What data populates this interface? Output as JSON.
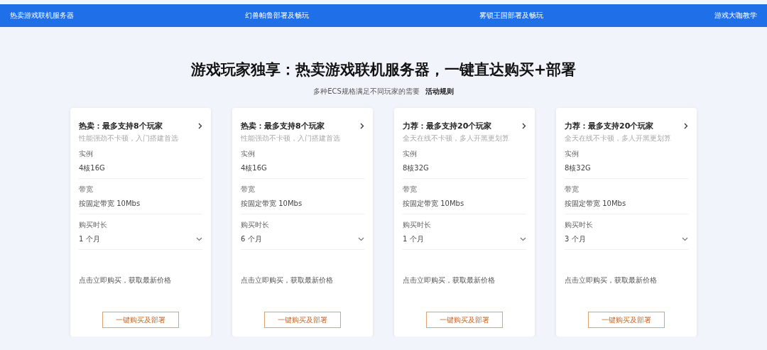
{
  "nav": {
    "items": [
      "热卖游戏联机服务器",
      "幻兽帕鲁部署及畅玩",
      "雾锁王国部署及畅玩",
      "游戏大咖教学"
    ]
  },
  "hero": {
    "title": "游戏玩家独享：热卖游戏联机服务器，一键直达购买+部署",
    "subtitle": "多种ECS规格满足不同玩家的需要",
    "rules_link": "活动规则"
  },
  "cards": [
    {
      "title": "热卖：最多支持8个玩家",
      "subtitle": "性能强劲不卡顿，入门搭建首选",
      "fields": [
        {
          "label": "实例",
          "value": "4核16G",
          "kind": "text"
        },
        {
          "label": "带宽",
          "value": "按固定带宽 10Mbs",
          "kind": "text"
        },
        {
          "label": "购买时长",
          "value": "1 个月",
          "kind": "select"
        }
      ],
      "note": "点击立即购买，获取最新价格",
      "button": "一键购买及部署"
    },
    {
      "title": "热卖：最多支持8个玩家",
      "subtitle": "性能强劲不卡顿，入门搭建首选",
      "fields": [
        {
          "label": "实例",
          "value": "4核16G",
          "kind": "text"
        },
        {
          "label": "带宽",
          "value": "按固定带宽 10Mbs",
          "kind": "text"
        },
        {
          "label": "购买时长",
          "value": "6 个月",
          "kind": "select"
        }
      ],
      "note": "点击立即购买，获取最新价格",
      "button": "一键购买及部署"
    },
    {
      "title": "力荐：最多支持20个玩家",
      "subtitle": "全天在线不卡顿，多人开黑更划算",
      "fields": [
        {
          "label": "实例",
          "value": "8核32G",
          "kind": "text"
        },
        {
          "label": "带宽",
          "value": "按固定带宽 10Mbs",
          "kind": "text"
        },
        {
          "label": "购买时长",
          "value": "1 个月",
          "kind": "select"
        }
      ],
      "note": "点击立即购买，获取最新价格",
      "button": "一键购买及部署"
    },
    {
      "title": "力荐：最多支持20个玩家",
      "subtitle": "全天在线不卡顿，多人开黑更划算",
      "fields": [
        {
          "label": "实例",
          "value": "8核32G",
          "kind": "text"
        },
        {
          "label": "带宽",
          "value": "按固定带宽 10Mbs",
          "kind": "text"
        },
        {
          "label": "购买时长",
          "value": "3 个月",
          "kind": "select"
        }
      ],
      "note": "点击立即购买，获取最新价格",
      "button": "一键购买及部署"
    }
  ]
}
